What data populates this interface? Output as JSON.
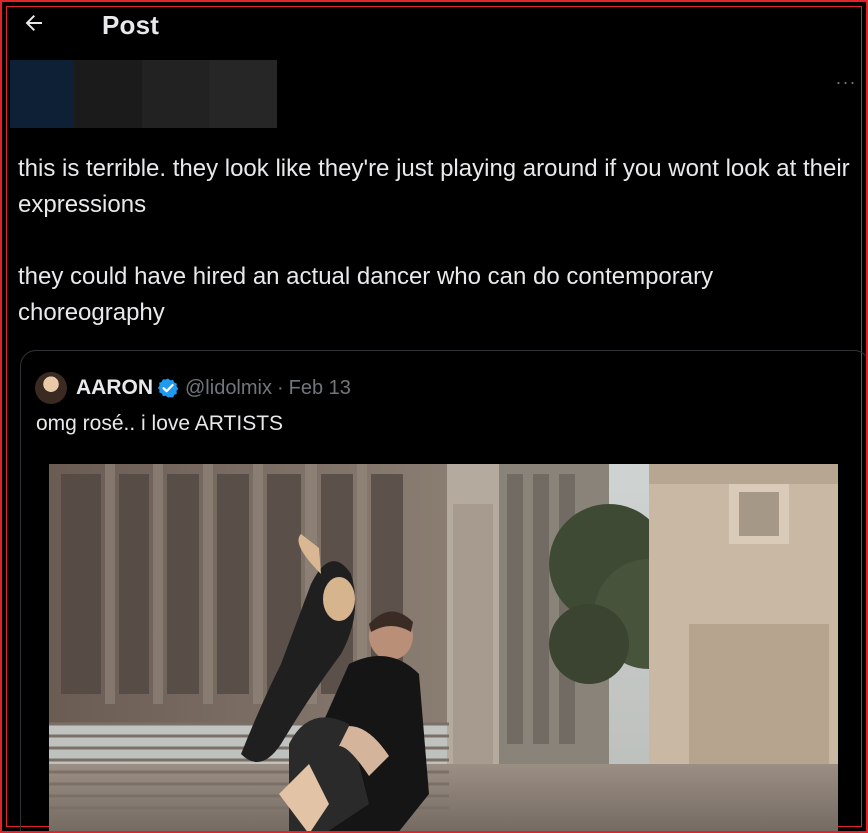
{
  "header": {
    "title": "Post"
  },
  "post": {
    "paragraphs": [
      "this is terrible. they look like they're just playing around if you wont look at their expressions",
      "they could have hired an actual dancer who can do contemporary choreography"
    ],
    "more_icon_text": "···"
  },
  "quote": {
    "author_name": "AARON",
    "handle": "@lidolmix",
    "separator": "·",
    "date": "Feb 13",
    "text": "omg rosé.. i love ARTISTS",
    "verified": true
  },
  "colors": {
    "background": "#000000",
    "text_primary": "#e7e9ea",
    "text_secondary": "#71767b",
    "border": "#2f3336",
    "verified_blue": "#1d9bf0",
    "highlight_border": "#e0242a"
  },
  "icons": {
    "back": "arrow-left-icon",
    "more": "more-horizontal-icon",
    "verified": "verified-badge-icon"
  }
}
